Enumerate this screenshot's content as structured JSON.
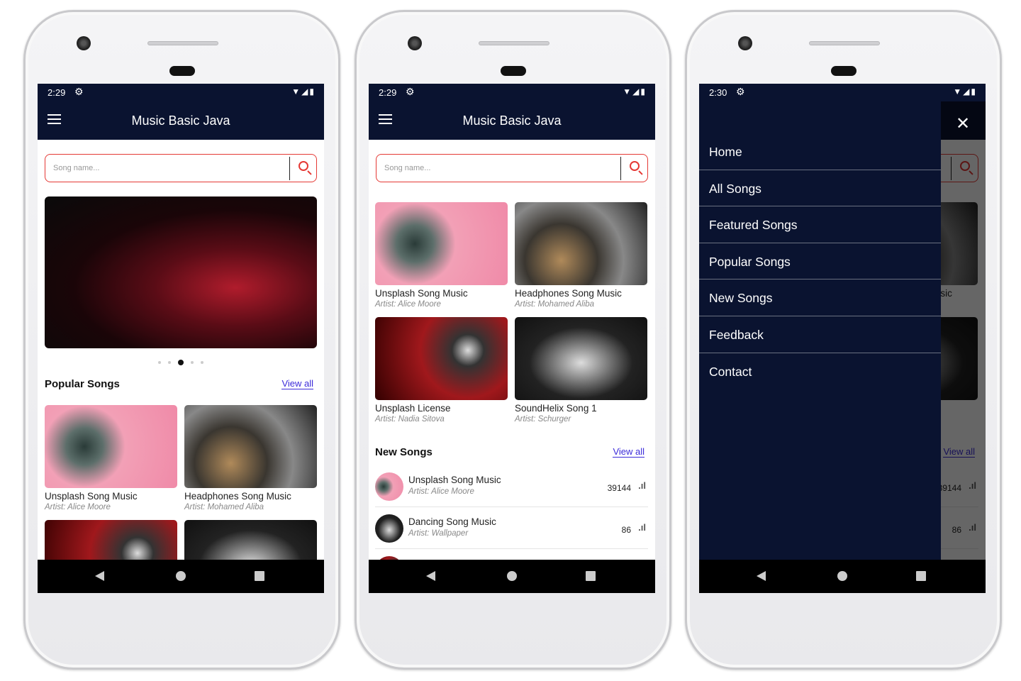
{
  "app": {
    "title": "Music Basic Java",
    "search_placeholder": "Song name...",
    "view_all": "View all"
  },
  "phones": [
    {
      "time": "2:29"
    },
    {
      "time": "2:29"
    },
    {
      "time": "2:30"
    }
  ],
  "status_icons": [
    "gear-icon",
    "wifi-icon",
    "signal-icon",
    "battery-icon"
  ],
  "home": {
    "section": "Popular Songs",
    "carousel": {
      "pages": 5,
      "active": 3
    },
    "cards": [
      {
        "title": "Unsplash Song Music",
        "artist": "Artist:  Alice Moore"
      },
      {
        "title": "Headphones Song Music",
        "artist": "Artist:  Mohamed Aliba"
      }
    ]
  },
  "featured": {
    "cards": [
      {
        "title": "Unsplash Song Music",
        "artist": "Artist:  Alice Moore"
      },
      {
        "title": "Headphones Song Music",
        "artist": "Artist:  Mohamed Aliba"
      },
      {
        "title": "Unsplash License",
        "artist": "Artist:  Nadia Sitova"
      },
      {
        "title": "SoundHelix Song 1",
        "artist": "Artist:  Schurger"
      }
    ],
    "new_section": "New Songs",
    "new_songs": [
      {
        "title": "Unsplash Song Music",
        "artist": "Artist:  Alice Moore",
        "plays": "39144"
      },
      {
        "title": "Dancing Song Music",
        "artist": "Artist:  Wallpaper",
        "plays": "86"
      }
    ]
  },
  "drawer": {
    "items": [
      "Home",
      "All Songs",
      "Featured Songs",
      "Popular Songs",
      "New Songs",
      "Feedback",
      "Contact"
    ]
  },
  "colors": {
    "primary": "#0a1330",
    "accent": "#e53935",
    "link": "#3b2bd9"
  }
}
